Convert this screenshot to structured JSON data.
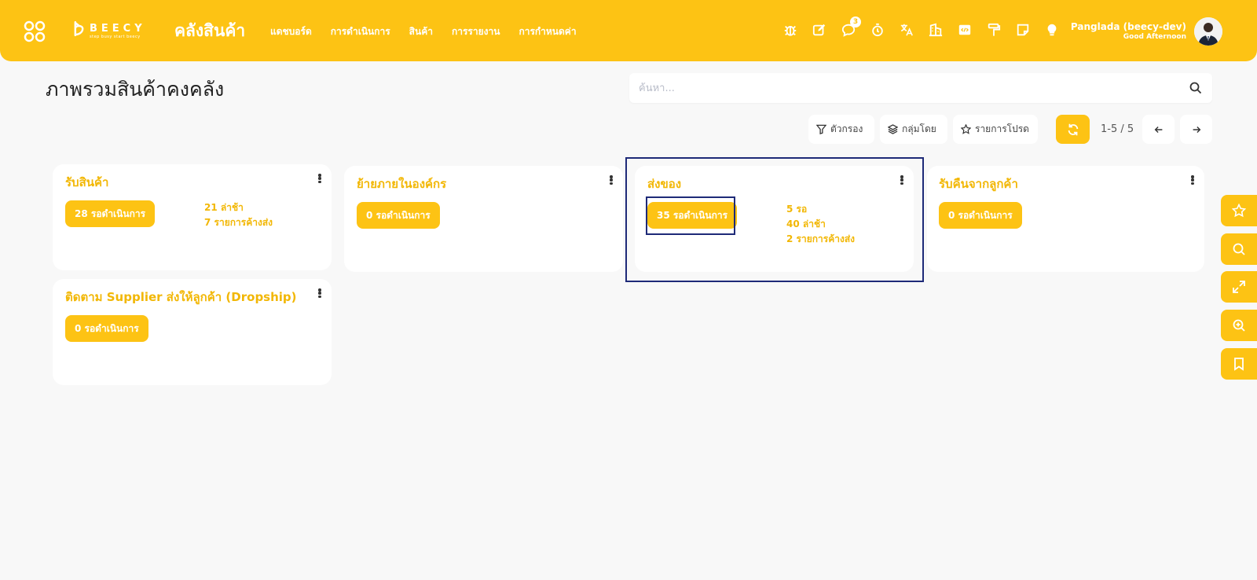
{
  "header": {
    "logo_name": "BEECY",
    "logo_tagline": "step busy start beecy",
    "module_title": "คลังสินค้า",
    "nav": [
      "แดชบอร์ด",
      "การดำเนินการ",
      "สินค้า",
      "การรายงาน",
      "การกำหนดค่า"
    ],
    "tools": [
      "bug-icon",
      "edit-icon",
      "chat-icon",
      "timer-icon",
      "translate-icon",
      "building-icon",
      "code-icon",
      "paint-roller-icon",
      "sticky-note-icon",
      "lightbulb-icon"
    ],
    "chat_badge": "3",
    "user_name": "Panglada (beecy-dev)",
    "greeting": "Good Afternoon"
  },
  "page": {
    "title": "ภาพรวมสินค้าคงคลัง",
    "search_placeholder": "ค้นหา...",
    "filter_label": "ตัวกรอง",
    "group_label": "กลุ่มโดย",
    "favorites_label": "รายการโปรด",
    "pager": "1-5 / 5"
  },
  "cards": [
    {
      "title": "รับสินค้า",
      "pending": "28 รอดำเนินการ",
      "stats": [
        "21 ล่าช้า",
        "7 รายการค้างส่ง"
      ]
    },
    {
      "title": "ย้ายภายในองค์กร",
      "pending": "0 รอดำเนินการ",
      "stats": []
    },
    {
      "title": "ส่งของ",
      "pending": "35 รอดำเนินการ",
      "stats": [
        "5 รอ",
        "40 ล่าช้า",
        "2 รายการค้างส่ง"
      ]
    },
    {
      "title": "รับคืนจากลูกค้า",
      "pending": "0 รอดำเนินการ",
      "stats": []
    },
    {
      "title": "ติดตาม Supplier ส่งให้ลูกค้า (Dropship)",
      "pending": "0 รอดำเนินการ",
      "stats": []
    }
  ],
  "side_dock": [
    "star-icon",
    "search-icon",
    "expand-icon",
    "zoom-in-icon",
    "bookmark-icon"
  ],
  "colors": {
    "primary": "#fdc314",
    "accent_text": "#f2b705",
    "highlight": "#1e2a78"
  }
}
